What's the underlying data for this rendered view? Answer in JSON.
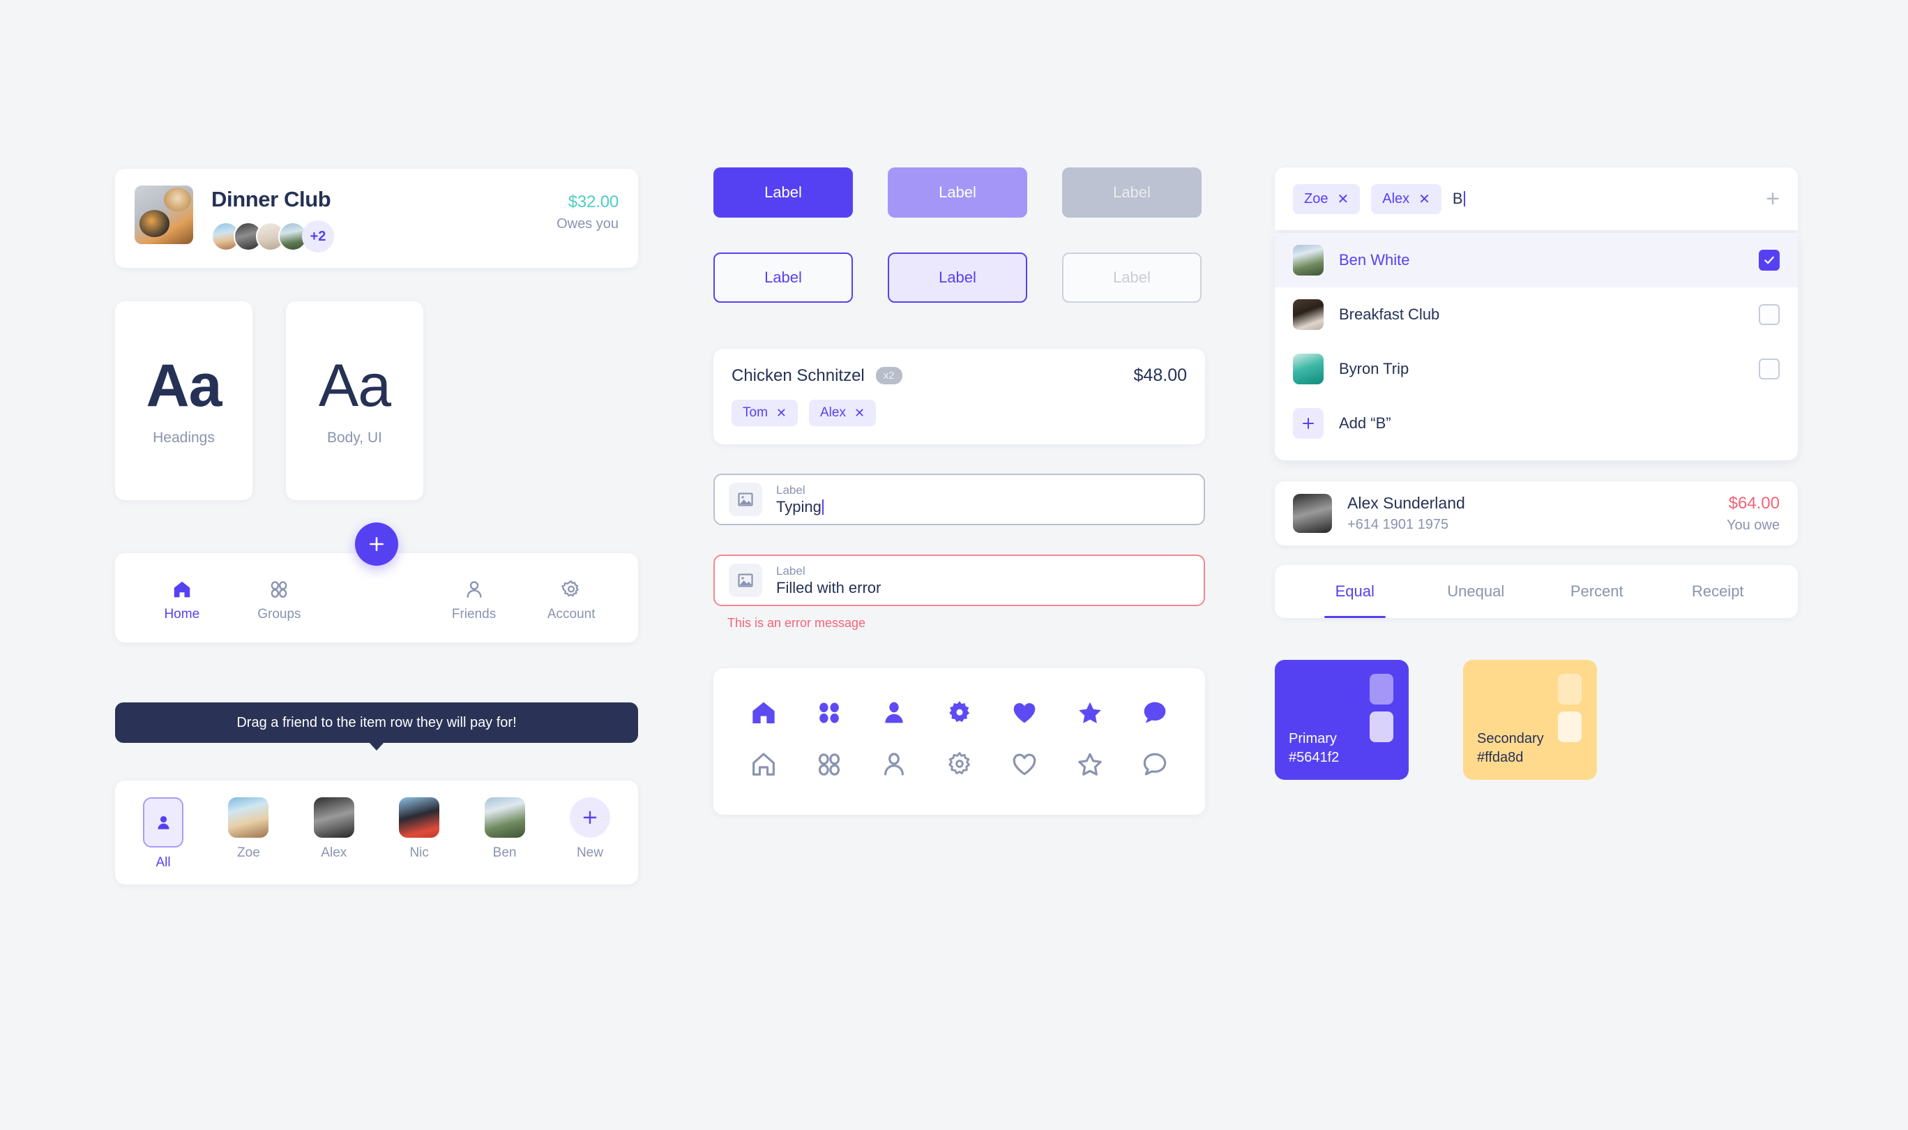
{
  "theme": {
    "bg": "#f4f5f7",
    "primary": "#5641f2",
    "primary_light": "#a496f7",
    "secondary": "#ffda8d",
    "positive": "#4ecdc4",
    "negative": "#f2637a",
    "ink": "#253155",
    "muted": "#8a93b0"
  },
  "group_card": {
    "title": "Dinner Club",
    "avatar_overflow": "+2",
    "amount": "$32.00",
    "amount_sub": "Owes you"
  },
  "typography": [
    {
      "sample": "Aa",
      "label": "Headings"
    },
    {
      "sample": "Aa",
      "label": "Body, UI"
    }
  ],
  "tabbar": {
    "fab_label": "+",
    "items": [
      {
        "label": "Home",
        "icon": "home-icon",
        "active": true
      },
      {
        "label": "Groups",
        "icon": "groups-icon",
        "active": false
      },
      {
        "label": "",
        "icon": "",
        "active": false
      },
      {
        "label": "Friends",
        "icon": "person-icon",
        "active": false
      },
      {
        "label": "Account",
        "icon": "gear-icon",
        "active": false
      }
    ]
  },
  "tooltip": {
    "text": "Drag a friend to the item row they will pay for!"
  },
  "friend_picker": [
    {
      "label": "All",
      "type": "all",
      "active": true
    },
    {
      "label": "Zoe",
      "type": "photo",
      "active": false
    },
    {
      "label": "Alex",
      "type": "photo",
      "active": false
    },
    {
      "label": "Nic",
      "type": "photo",
      "active": false
    },
    {
      "label": "Ben",
      "type": "photo",
      "active": false
    },
    {
      "label": "New",
      "type": "add",
      "active": false
    }
  ],
  "buttons": [
    {
      "label": "Label",
      "style": "primary"
    },
    {
      "label": "Label",
      "style": "light"
    },
    {
      "label": "Label",
      "style": "disabled"
    },
    {
      "label": "Label",
      "style": "out"
    },
    {
      "label": "Label",
      "style": "out-fill"
    },
    {
      "label": "Label",
      "style": "out-dis"
    }
  ],
  "item_row": {
    "name": "Chicken Schnitzel",
    "qty": "x2",
    "price": "$48.00",
    "chips": [
      {
        "label": "Tom",
        "remove": "✕"
      },
      {
        "label": "Alex",
        "remove": "✕"
      }
    ]
  },
  "fields": [
    {
      "label": "Label",
      "value": "Typing",
      "state": "focus",
      "icon": "image-icon",
      "caret": true
    },
    {
      "label": "Label",
      "value": "Filled with error",
      "state": "error",
      "icon": "image-icon",
      "caret": false
    }
  ],
  "error_message": "This is an error message",
  "icon_set": {
    "filled": [
      "home-icon",
      "grid-icon",
      "person-icon",
      "gear-icon",
      "heart-icon",
      "star-icon",
      "chat-icon"
    ],
    "outline": [
      "home-icon",
      "grid-icon",
      "person-icon",
      "gear-icon",
      "heart-icon",
      "star-icon",
      "chat-icon"
    ]
  },
  "token_input": {
    "tokens": [
      {
        "label": "Zoe",
        "remove": "✕"
      },
      {
        "label": "Alex",
        "remove": "✕"
      }
    ],
    "typed": "B",
    "add_icon": "plus-icon"
  },
  "dropdown": [
    {
      "name": "Ben White",
      "selected": true,
      "checked": true,
      "type": "photo"
    },
    {
      "name": "Breakfast Club",
      "selected": false,
      "checked": false,
      "type": "photo"
    },
    {
      "name": "Byron Trip",
      "selected": false,
      "checked": false,
      "type": "photo"
    },
    {
      "name": "Add “B”",
      "selected": false,
      "checked": null,
      "type": "add"
    }
  ],
  "person_card": {
    "name": "Alex Sunderland",
    "phone": "+614 1901 1975",
    "amount": "$64.00",
    "amount_sub": "You owe"
  },
  "split_tabs": [
    {
      "label": "Equal",
      "active": true
    },
    {
      "label": "Unequal",
      "active": false
    },
    {
      "label": "Percent",
      "active": false
    },
    {
      "label": "Receipt",
      "active": false
    }
  ],
  "swatches": [
    {
      "name": "Primary",
      "hex": "#5641f2",
      "bg": "#5641f2",
      "text": "#ffffff",
      "chip1": "#a496f7",
      "chip2": "#d9d3fb"
    },
    {
      "name": "Secondary",
      "hex": "#ffda8d",
      "bg": "#ffda8d",
      "text": "#253155",
      "chip1": "#ffe9bc",
      "chip2": "#fff5e2"
    }
  ]
}
